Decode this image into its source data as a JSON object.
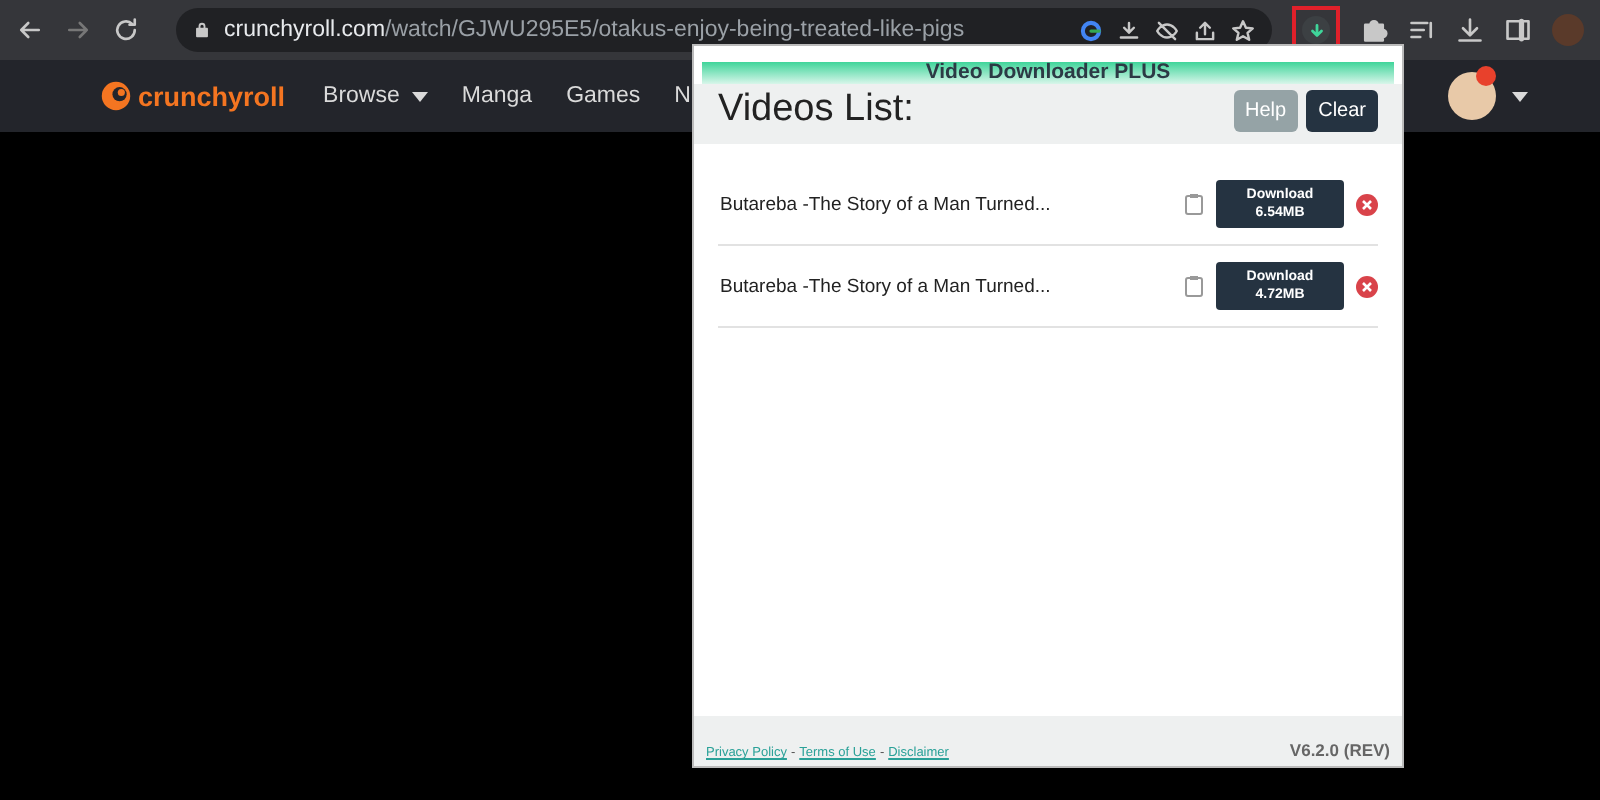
{
  "browser": {
    "url_host": "crunchyroll.com",
    "url_path": "/watch/GJWU295E5/otakus-enjoy-being-treated-like-pigs"
  },
  "site_nav": {
    "logo": "crunchyroll",
    "items": [
      {
        "label": "Browse",
        "dropdown": true
      },
      {
        "label": "Manga",
        "dropdown": false
      },
      {
        "label": "Games",
        "dropdown": false
      },
      {
        "label": "N",
        "dropdown": false
      }
    ]
  },
  "popup": {
    "title": "Video Downloader PLUS",
    "heading": "Videos List:",
    "buttons": [
      {
        "label": "Help",
        "kind": "secondary"
      },
      {
        "label": "Clear",
        "kind": "primary"
      }
    ],
    "videos": [
      {
        "title": "Butareba -The Story of a Man Turned...",
        "action": "Download",
        "size": "6.54MB"
      },
      {
        "title": "Butareba -The Story of a Man Turned...",
        "action": "Download",
        "size": "4.72MB"
      }
    ],
    "footer": {
      "links": [
        "Privacy Policy",
        "Terms of Use",
        "Disclaimer"
      ],
      "separator": "-",
      "version": "V6.2.0 (REV)"
    }
  }
}
